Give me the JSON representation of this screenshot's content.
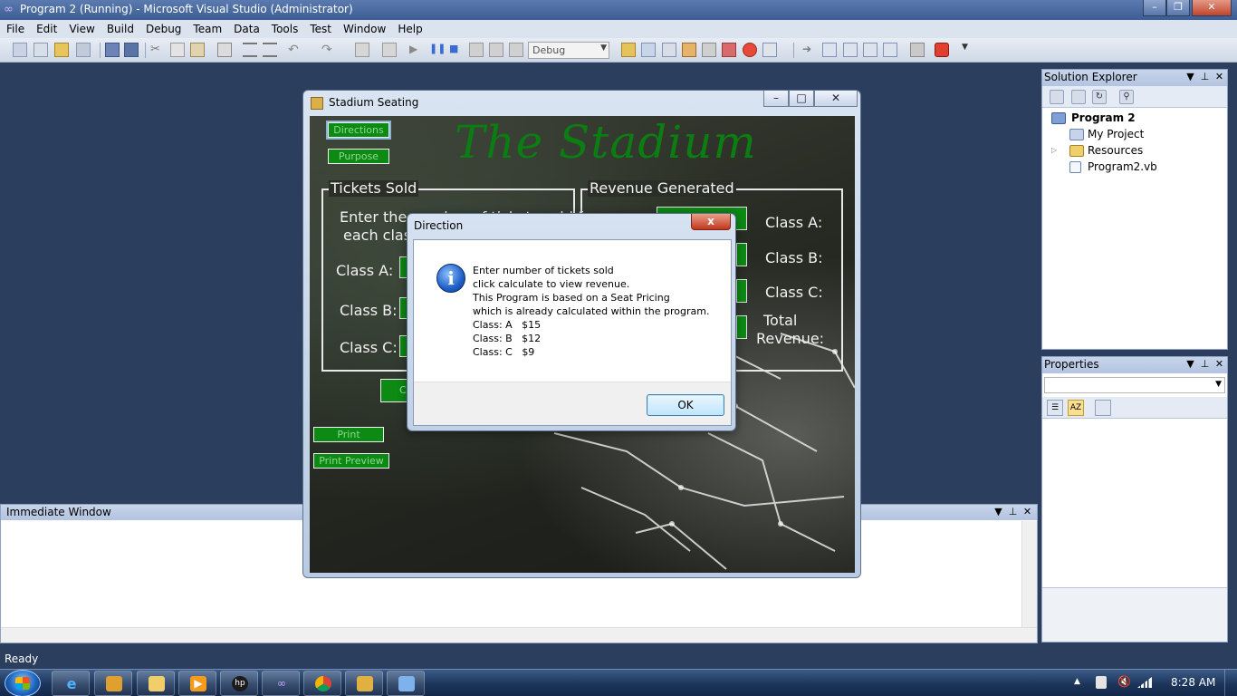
{
  "window": {
    "title": "Program 2 (Running) - Microsoft Visual Studio (Administrator)",
    "controls": [
      "–",
      "❐",
      "✕"
    ]
  },
  "menu": [
    "File",
    "Edit",
    "View",
    "Build",
    "Debug",
    "Team",
    "Data",
    "Tools",
    "Test",
    "Window",
    "Help"
  ],
  "toolbar": {
    "config_value": "Debug"
  },
  "solution_explorer": {
    "title": "Solution Explorer",
    "items": [
      {
        "label": "Program 2",
        "icon": "vb-project-icon"
      },
      {
        "label": "My Project",
        "icon": "my-project-icon"
      },
      {
        "label": "Resources",
        "icon": "folder-icon"
      },
      {
        "label": "Program2.vb",
        "icon": "vb-file-icon"
      }
    ]
  },
  "properties": {
    "title": "Properties"
  },
  "immediate": {
    "title": "Immediate Window"
  },
  "status": {
    "text": "Ready"
  },
  "taskbar": {
    "clock": "8:28 AM"
  },
  "stadium_window": {
    "title": "Stadium Seating",
    "heading": "The Stadium",
    "buttons": {
      "directions": "Directions",
      "purpose": "Purpose",
      "print": "Print",
      "print_preview": "Print Preview",
      "calculate_partial": "C"
    },
    "tickets_group": {
      "title": "Tickets Sold",
      "instructions_line1": "Enter the number of tickets sold for",
      "instructions_line2": "each class",
      "class_a": "Class A:",
      "class_b": "Class B:",
      "class_c": "Class C:"
    },
    "revenue_group": {
      "title": "Revenue Generated",
      "class_a": "Class A:",
      "class_b": "Class B:",
      "class_c": "Class C:",
      "total_line1": "Total",
      "total_line2": "Revenue:"
    }
  },
  "direction_dialog": {
    "title": "Direction",
    "close": "x",
    "icon": "info-icon",
    "message": [
      "Enter number of tickets sold",
      "click calculate to view revenue.",
      "This Program is based on a Seat Pricing",
      "which is already calculated within the program.",
      "Class: A   $15",
      "Class: B   $12",
      "Class: C   $9"
    ],
    "ok": "OK"
  },
  "colors": {
    "stadium_green": "#0c8a14",
    "vs_background": "#2c3e5e"
  }
}
